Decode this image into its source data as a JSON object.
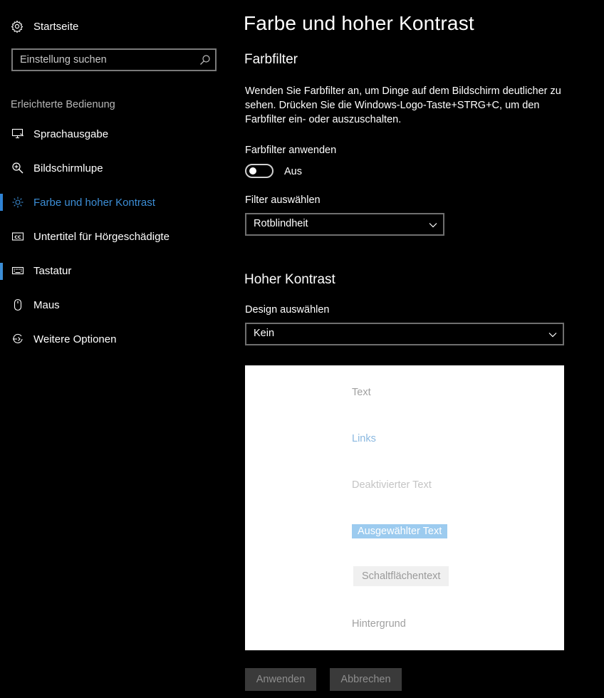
{
  "sidebar": {
    "home_label": "Startseite",
    "search_placeholder": "Einstellung suchen",
    "section_label": "Erleichterte Bedienung",
    "items": [
      {
        "label": "Sprachausgabe",
        "icon": "narrator-icon"
      },
      {
        "label": "Bildschirmlupe",
        "icon": "magnifier-icon"
      },
      {
        "label": "Farbe und hoher Kontrast",
        "icon": "brightness-icon",
        "active": true
      },
      {
        "label": "Untertitel für Hörgeschädigte",
        "icon": "closed-captions-icon"
      },
      {
        "label": "Tastatur",
        "icon": "keyboard-icon"
      },
      {
        "label": "Maus",
        "icon": "mouse-icon"
      },
      {
        "label": "Weitere Optionen",
        "icon": "more-options-icon"
      }
    ],
    "accent_color": "#3c8ed6"
  },
  "main": {
    "title": "Farbe und hoher Kontrast",
    "color_filter": {
      "heading": "Farbfilter",
      "description": "Wenden Sie Farbfilter an, um Dinge auf dem Bildschirm deutlicher zu sehen. Drücken Sie die Windows-Logo-Taste+STRG+C, um den Farbfilter ein- oder auszuschalten.",
      "toggle_label": "Farbfilter anwenden",
      "toggle_state": "Aus",
      "toggle_on": false,
      "select_label": "Filter auswählen",
      "select_value": "Rotblindheit"
    },
    "high_contrast": {
      "heading": "Hoher Kontrast",
      "select_label": "Design auswählen",
      "select_value": "Kein",
      "preview": {
        "text": "Text",
        "links": "Links",
        "disabled": "Deaktivierter Text",
        "selected": "Ausgewählter Text",
        "button": "Schaltflächentext",
        "background": "Hintergrund"
      },
      "apply_label": "Anwenden",
      "cancel_label": "Abbrechen"
    }
  }
}
